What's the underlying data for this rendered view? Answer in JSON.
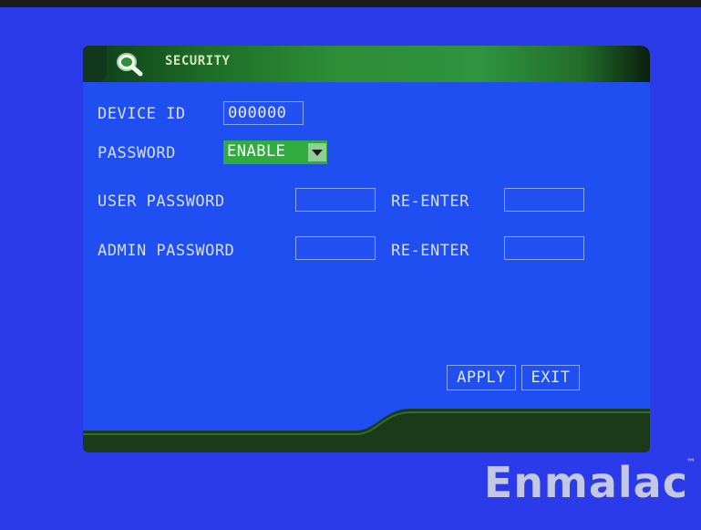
{
  "window": {
    "title": "SECURITY",
    "icon": "magnifier-icon"
  },
  "device_id": {
    "label": "DEVICE ID",
    "value": "000000"
  },
  "password": {
    "label": "PASSWORD",
    "selected": "ENABLE"
  },
  "user_password": {
    "label": "USER PASSWORD",
    "value": "",
    "reenter_label": "RE-ENTER",
    "reenter_value": ""
  },
  "admin_password": {
    "label": "ADMIN PASSWORD",
    "value": "",
    "reenter_label": "RE-ENTER",
    "reenter_value": ""
  },
  "buttons": {
    "apply": "APPLY",
    "exit": "EXIT"
  },
  "brand": {
    "name": "Enmalac",
    "tm": "™"
  },
  "colors": {
    "background": "#2c3be9",
    "panel": "#1f4ff0",
    "title_green": "#2d8f36",
    "select_green": "#2fab3f",
    "field_border": "#8da7ff"
  }
}
